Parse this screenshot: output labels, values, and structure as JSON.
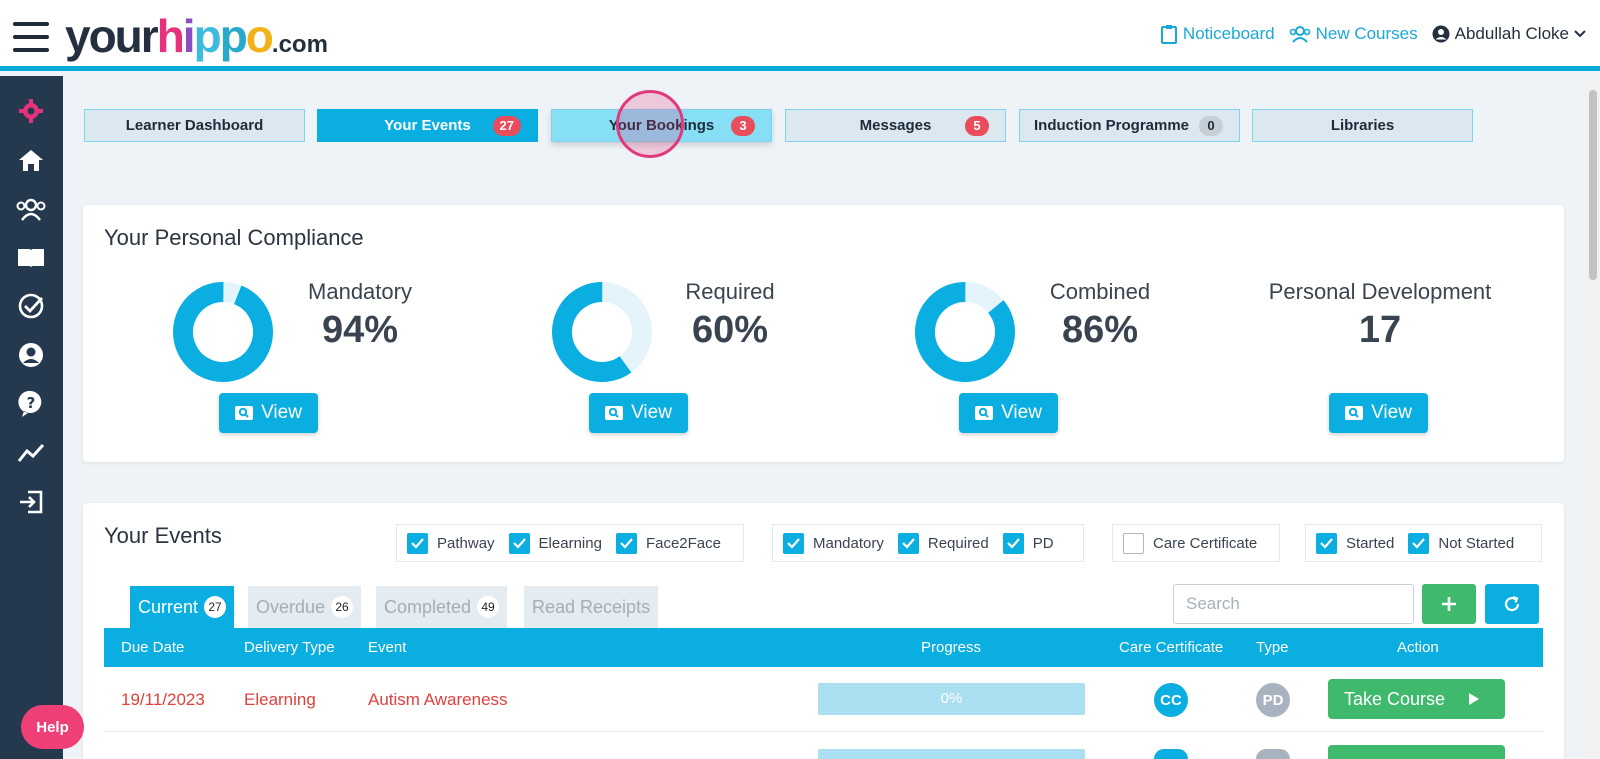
{
  "header": {
    "logo": {
      "your": "your",
      "h": "h",
      "i": "i",
      "p1": "p",
      "p2": "p",
      "o": "o",
      "com": ".com"
    },
    "noticeboard": "Noticeboard",
    "new_courses": "New Courses",
    "user_name": "Abdullah Cloke"
  },
  "sidebar": {
    "icons": [
      "gear-icon",
      "home-icon",
      "users-icon",
      "book-icon",
      "check-circle-icon",
      "user-circle-icon",
      "question-icon",
      "trend-icon",
      "logout-icon"
    ]
  },
  "tabs": [
    {
      "label": "Learner Dashboard",
      "badge": ""
    },
    {
      "label": "Your Events",
      "badge": "27"
    },
    {
      "label": "Your Bookings",
      "badge": "3"
    },
    {
      "label": "Messages",
      "badge": "5"
    },
    {
      "label": "Induction Programme",
      "badge": "0"
    },
    {
      "label": "Libraries",
      "badge": ""
    }
  ],
  "compliance": {
    "title": "Your Personal Compliance",
    "metrics": [
      {
        "label": "Mandatory",
        "value": "94%",
        "percent": 94
      },
      {
        "label": "Required",
        "value": "60%",
        "percent": 60
      },
      {
        "label": "Combined",
        "value": "86%",
        "percent": 86
      },
      {
        "label": "Personal Development",
        "value": "17"
      }
    ],
    "view_label": "View"
  },
  "events": {
    "title": "Your Events",
    "filters": {
      "group1": [
        {
          "label": "Pathway",
          "checked": true
        },
        {
          "label": "Elearning",
          "checked": true
        },
        {
          "label": "Face2Face",
          "checked": true
        }
      ],
      "group2": [
        {
          "label": "Mandatory",
          "checked": true
        },
        {
          "label": "Required",
          "checked": true
        },
        {
          "label": "PD",
          "checked": true
        }
      ],
      "group3": [
        {
          "label": "Care Certificate",
          "checked": false
        }
      ],
      "group4": [
        {
          "label": "Started",
          "checked": true
        },
        {
          "label": "Not Started",
          "checked": true
        }
      ]
    },
    "tabs": [
      {
        "label": "Current",
        "count": "27"
      },
      {
        "label": "Overdue",
        "count": "26"
      },
      {
        "label": "Completed",
        "count": "49"
      },
      {
        "label": "Read Receipts",
        "count": ""
      }
    ],
    "search_placeholder": "Search",
    "columns": [
      "Due Date",
      "Delivery Type",
      "Event",
      "Progress",
      "Care Certificate",
      "Type",
      "Action"
    ],
    "rows": [
      {
        "due_date": "19/11/2023",
        "delivery_type": "Elearning",
        "event": "Autism Awareness",
        "progress": "0%",
        "care_certificate": "CC",
        "type": "PD",
        "action": "Take Course"
      }
    ]
  },
  "help_label": "Help",
  "colors": {
    "accent": "#0aaee0",
    "brand_dark": "#24394d",
    "danger": "#e0413c",
    "success": "#3fba6c",
    "pink": "#ee3f77"
  }
}
